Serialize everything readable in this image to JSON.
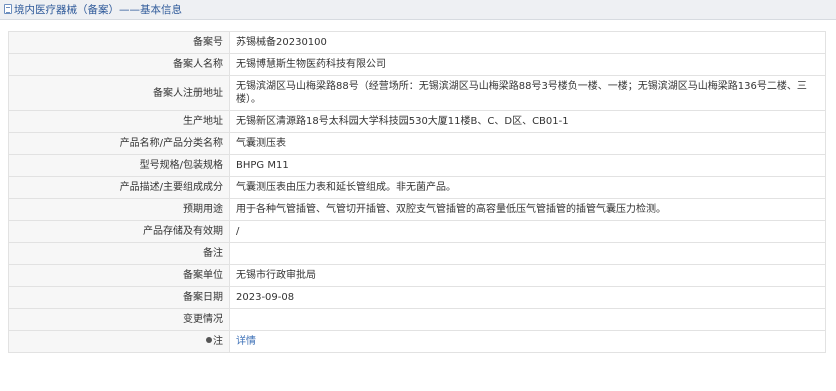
{
  "header": {
    "title": "境内医疗器械（备案）——基本信息"
  },
  "rows": [
    {
      "label": "备案号",
      "value": "苏锡械备20230100"
    },
    {
      "label": "备案人名称",
      "value": "无锡博慧斯生物医药科技有限公司"
    },
    {
      "label": "备案人注册地址",
      "value": "无锡滨湖区马山梅梁路88号（经营场所：无锡滨湖区马山梅梁路88号3号楼负一楼、一楼；无锡滨湖区马山梅梁路136号二楼、三楼）。"
    },
    {
      "label": "生产地址",
      "value": "无锡新区清源路18号太科园大学科技园530大厦11楼B、C、D区、CB01-1"
    },
    {
      "label": "产品名称/产品分类名称",
      "value": "气囊测压表"
    },
    {
      "label": "型号规格/包装规格",
      "value": "BHPG M11"
    },
    {
      "label": "产品描述/主要组成成分",
      "value": "气囊测压表由压力表和延长管组成。非无菌产品。"
    },
    {
      "label": "预期用途",
      "value": "用于各种气管插管、气管切开插管、双腔支气管插管的高容量低压气管插管的插管气囊压力检测。"
    },
    {
      "label": "产品存储及有效期",
      "value": "/"
    },
    {
      "label": "备注",
      "value": ""
    },
    {
      "label": "备案单位",
      "value": "无锡市行政审批局"
    },
    {
      "label": "备案日期",
      "value": "2023-09-08"
    },
    {
      "label": "变更情况",
      "value": ""
    },
    {
      "label": "注",
      "value": "详情"
    }
  ]
}
